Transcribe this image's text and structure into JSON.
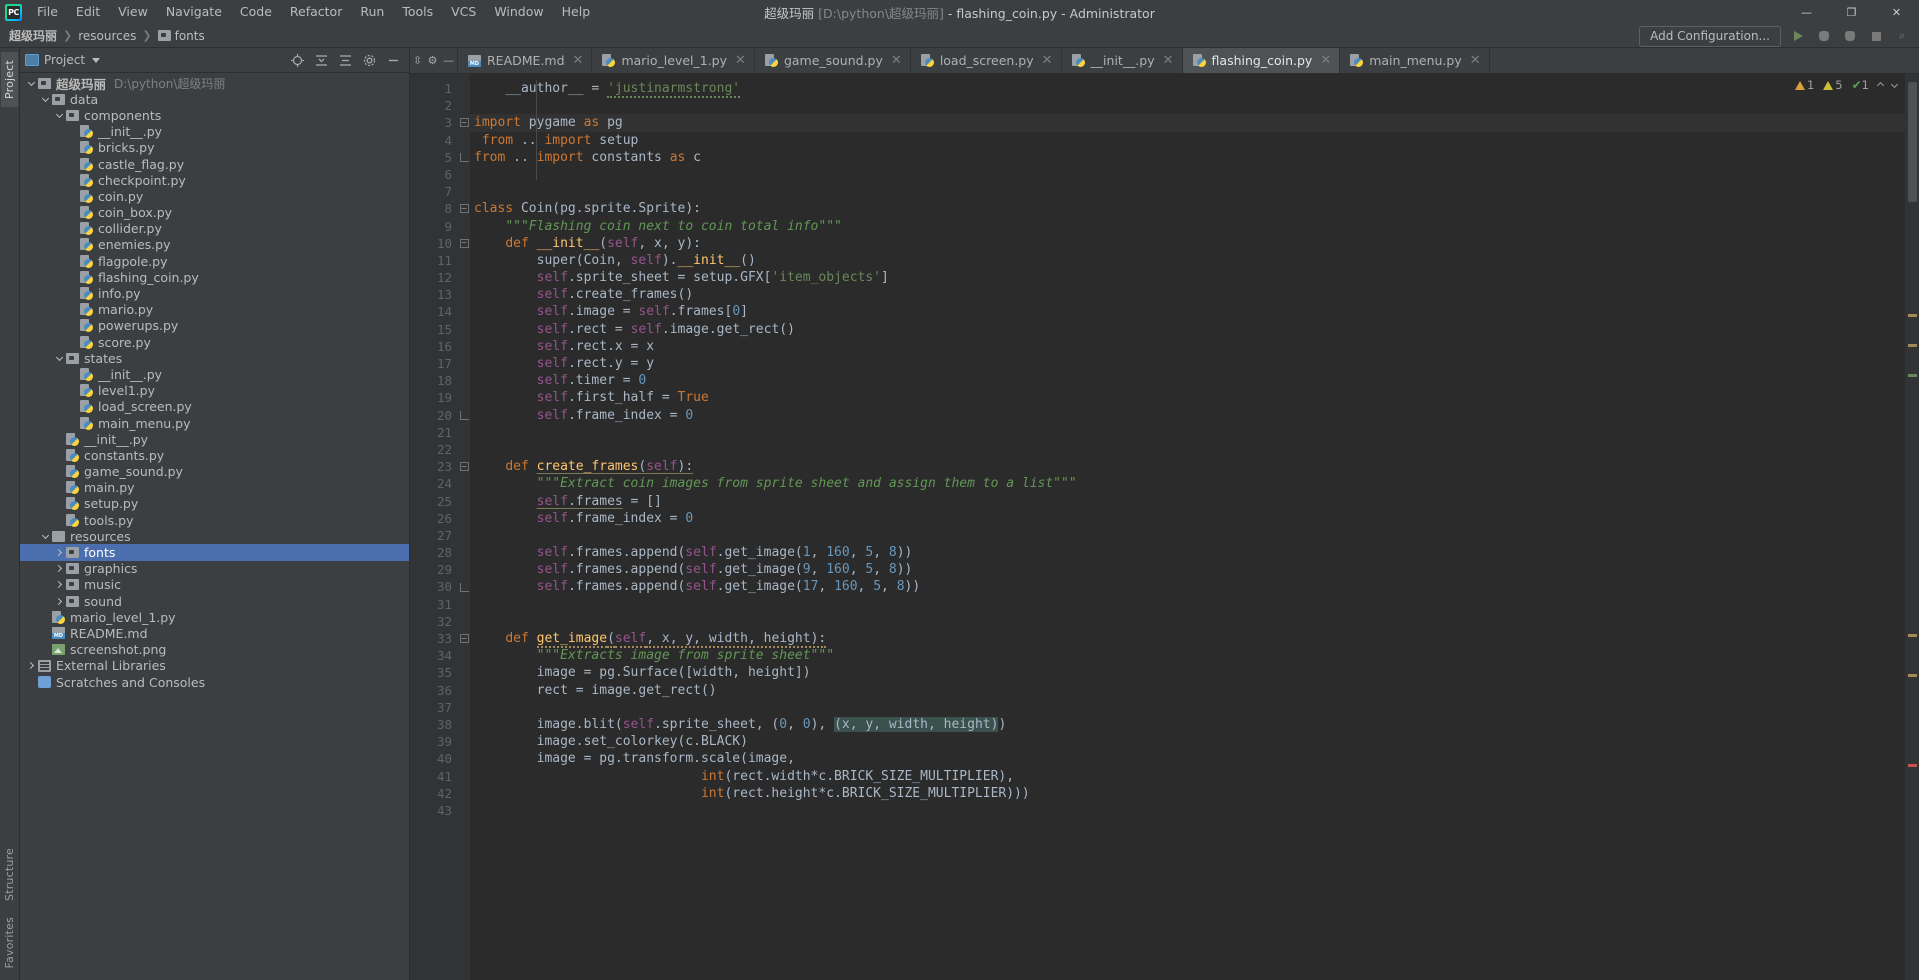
{
  "window": {
    "title_project": "超级玛丽",
    "title_path": "[D:\\python\\超级玛丽]",
    "title_file": "- flashing_coin.py - Administrator",
    "full_title": "超级玛丽 [D:\\python\\超级玛丽] - flashing_coin.py - Administrator",
    "minimize": "—",
    "maximize": "❐",
    "close": "✕"
  },
  "menubar": {
    "logo": "pycharm-logo",
    "items": [
      "File",
      "Edit",
      "View",
      "Navigate",
      "Code",
      "Refactor",
      "Run",
      "Tools",
      "VCS",
      "Window",
      "Help"
    ]
  },
  "breadcrumb": {
    "items": [
      {
        "label": "超级玛丽",
        "icon": "none",
        "bold": true
      },
      {
        "label": "resources",
        "icon": "none",
        "bold": false
      },
      {
        "label": "fonts",
        "icon": "folder-icon",
        "bold": false
      }
    ],
    "separator": "❯"
  },
  "run_toolbar": {
    "add_configuration": "Add Configuration...",
    "buttons": [
      "run-button",
      "debug-button",
      "coverage-button",
      "stop-button",
      "more-button"
    ]
  },
  "left_strip": {
    "project_tab": "Project",
    "structure_tab": "Structure",
    "favorites_tab": "Favorites"
  },
  "project_panel": {
    "title": "Project",
    "actions": [
      "locate-icon",
      "collapse-all-icon",
      "expand-icon",
      "settings-icon",
      "hide-icon"
    ],
    "tree": [
      {
        "depth": 0,
        "arrow": "down",
        "icon": "folder",
        "label": "超级玛丽",
        "bold": true,
        "path": "D:\\python\\超级玛丽",
        "selected": false
      },
      {
        "depth": 1,
        "arrow": "down",
        "icon": "folder",
        "label": "data",
        "selected": false
      },
      {
        "depth": 2,
        "arrow": "down",
        "icon": "folder",
        "label": "components",
        "selected": false
      },
      {
        "depth": 3,
        "arrow": "none",
        "icon": "py",
        "label": "__init__.py",
        "selected": false
      },
      {
        "depth": 3,
        "arrow": "none",
        "icon": "py",
        "label": "bricks.py",
        "selected": false
      },
      {
        "depth": 3,
        "arrow": "none",
        "icon": "py",
        "label": "castle_flag.py",
        "selected": false
      },
      {
        "depth": 3,
        "arrow": "none",
        "icon": "py",
        "label": "checkpoint.py",
        "selected": false
      },
      {
        "depth": 3,
        "arrow": "none",
        "icon": "py",
        "label": "coin.py",
        "selected": false
      },
      {
        "depth": 3,
        "arrow": "none",
        "icon": "py",
        "label": "coin_box.py",
        "selected": false
      },
      {
        "depth": 3,
        "arrow": "none",
        "icon": "py",
        "label": "collider.py",
        "selected": false
      },
      {
        "depth": 3,
        "arrow": "none",
        "icon": "py",
        "label": "enemies.py",
        "selected": false
      },
      {
        "depth": 3,
        "arrow": "none",
        "icon": "py",
        "label": "flagpole.py",
        "selected": false
      },
      {
        "depth": 3,
        "arrow": "none",
        "icon": "py",
        "label": "flashing_coin.py",
        "selected": false
      },
      {
        "depth": 3,
        "arrow": "none",
        "icon": "py",
        "label": "info.py",
        "selected": false
      },
      {
        "depth": 3,
        "arrow": "none",
        "icon": "py",
        "label": "mario.py",
        "selected": false
      },
      {
        "depth": 3,
        "arrow": "none",
        "icon": "py",
        "label": "powerups.py",
        "selected": false
      },
      {
        "depth": 3,
        "arrow": "none",
        "icon": "py",
        "label": "score.py",
        "selected": false
      },
      {
        "depth": 2,
        "arrow": "down",
        "icon": "folder",
        "label": "states",
        "selected": false
      },
      {
        "depth": 3,
        "arrow": "none",
        "icon": "py",
        "label": "__init__.py",
        "selected": false
      },
      {
        "depth": 3,
        "arrow": "none",
        "icon": "py",
        "label": "level1.py",
        "selected": false
      },
      {
        "depth": 3,
        "arrow": "none",
        "icon": "py",
        "label": "load_screen.py",
        "selected": false
      },
      {
        "depth": 3,
        "arrow": "none",
        "icon": "py",
        "label": "main_menu.py",
        "selected": false
      },
      {
        "depth": 2,
        "arrow": "none",
        "icon": "py",
        "label": "__init__.py",
        "selected": false
      },
      {
        "depth": 2,
        "arrow": "none",
        "icon": "py",
        "label": "constants.py",
        "selected": false
      },
      {
        "depth": 2,
        "arrow": "none",
        "icon": "py",
        "label": "game_sound.py",
        "selected": false
      },
      {
        "depth": 2,
        "arrow": "none",
        "icon": "py",
        "label": "main.py",
        "selected": false
      },
      {
        "depth": 2,
        "arrow": "none",
        "icon": "py",
        "label": "setup.py",
        "selected": false
      },
      {
        "depth": 2,
        "arrow": "none",
        "icon": "py",
        "label": "tools.py",
        "selected": false
      },
      {
        "depth": 1,
        "arrow": "down",
        "icon": "folder-plain",
        "label": "resources",
        "selected": false
      },
      {
        "depth": 2,
        "arrow": "right",
        "icon": "folder",
        "label": "fonts",
        "selected": true
      },
      {
        "depth": 2,
        "arrow": "right",
        "icon": "folder",
        "label": "graphics",
        "selected": false
      },
      {
        "depth": 2,
        "arrow": "right",
        "icon": "folder",
        "label": "music",
        "selected": false
      },
      {
        "depth": 2,
        "arrow": "right",
        "icon": "folder",
        "label": "sound",
        "selected": false
      },
      {
        "depth": 1,
        "arrow": "none",
        "icon": "py",
        "label": "mario_level_1.py",
        "selected": false
      },
      {
        "depth": 1,
        "arrow": "none",
        "icon": "md",
        "label": "README.md",
        "selected": false
      },
      {
        "depth": 1,
        "arrow": "none",
        "icon": "img",
        "label": "screenshot.png",
        "selected": false
      },
      {
        "depth": 0,
        "arrow": "right",
        "icon": "lib",
        "label": "External Libraries",
        "selected": false
      },
      {
        "depth": 0,
        "arrow": "none",
        "icon": "scratch",
        "label": "Scratches and Consoles",
        "selected": false
      }
    ]
  },
  "editor_tabs": [
    {
      "label": "README.md",
      "icon": "md-icon",
      "active": false,
      "close": "✕"
    },
    {
      "label": "mario_level_1.py",
      "icon": "py-icon",
      "active": false,
      "close": "✕"
    },
    {
      "label": "game_sound.py",
      "icon": "py-icon",
      "active": false,
      "close": "✕"
    },
    {
      "label": "load_screen.py",
      "icon": "py-icon",
      "active": false,
      "close": "✕"
    },
    {
      "label": "__init__.py",
      "icon": "py-icon",
      "active": false,
      "close": "✕"
    },
    {
      "label": "flashing_coin.py",
      "icon": "py-icon",
      "active": true,
      "close": "✕"
    },
    {
      "label": "main_menu.py",
      "icon": "py-icon",
      "active": false,
      "close": "✕"
    }
  ],
  "inspections": {
    "errors_count": "1",
    "warnings_count": "5",
    "weak_warnings_count": "1",
    "error_icon": "warning-triangle-icon",
    "warning_icon": "warning-triangle-icon",
    "ok_icon": "checkmark-icon",
    "prev_icon": "chevron-up-icon",
    "next_icon": "chevron-down-icon"
  },
  "editor": {
    "first_line": 1,
    "file": "flashing_coin.py",
    "lines": [
      {
        "n": 1,
        "fold": "none",
        "html": "<span class=\"pln\">    __author__ = </span><span class=\"str squig\">'justinarmstrong'</span>"
      },
      {
        "n": 2,
        "fold": "none",
        "html": ""
      },
      {
        "n": 3,
        "fold": "open",
        "hl": true,
        "html": "<span class=\"kw\">import</span><span class=\"pln\"> pygame </span><span class=\"kw\">as</span><span class=\"pln\"> pg</span>"
      },
      {
        "n": 4,
        "fold": "none",
        "html": " <span class=\"kw\">from</span><span class=\"pln\"> .. </span><span class=\"kw\">import</span><span class=\"pln\"> setup</span>"
      },
      {
        "n": 5,
        "fold": "end",
        "html": "<span class=\"kw\">from</span><span class=\"pln\"> .. </span><span class=\"kw\">import</span><span class=\"pln\"> constants </span><span class=\"kw\">as</span><span class=\"pln\"> c</span>"
      },
      {
        "n": 6,
        "fold": "none",
        "html": ""
      },
      {
        "n": 7,
        "fold": "none",
        "html": ""
      },
      {
        "n": 8,
        "fold": "open",
        "html": "<span class=\"kw\">class</span><span class=\"pln\"> Coin(pg.sprite.Sprite):</span>"
      },
      {
        "n": 9,
        "fold": "none",
        "html": "    <span class=\"cmt\">\"\"\"Flashing coin next to coin total info\"\"\"</span>"
      },
      {
        "n": 10,
        "fold": "open",
        "html": "    <span class=\"kw\">def</span><span class=\"pln\"> </span><span class=\"fn\">__init__</span><span class=\"pln\">(</span><span class=\"self\">self</span><span class=\"pln\">, x, y):</span>"
      },
      {
        "n": 11,
        "fold": "none",
        "html": "        <span class=\"pln\">super(Coin, </span><span class=\"self\">self</span><span class=\"pln\">).</span><span class=\"fn\">__init__</span><span class=\"pln\">()</span>"
      },
      {
        "n": 12,
        "fold": "none",
        "html": "        <span class=\"self\">self</span><span class=\"pln\">.sprite_sheet = setup.GFX[</span><span class=\"str\">'item_objects'</span><span class=\"pln\">]</span>"
      },
      {
        "n": 13,
        "fold": "none",
        "html": "        <span class=\"self\">self</span><span class=\"pln\">.create_frames()</span>"
      },
      {
        "n": 14,
        "fold": "none",
        "html": "        <span class=\"self\">self</span><span class=\"pln\">.image = </span><span class=\"self\">self</span><span class=\"pln\">.frames[</span><span class=\"num\">0</span><span class=\"pln\">]</span>"
      },
      {
        "n": 15,
        "fold": "none",
        "html": "        <span class=\"self\">self</span><span class=\"pln\">.rect = </span><span class=\"self\">self</span><span class=\"pln\">.image.get_rect()</span>"
      },
      {
        "n": 16,
        "fold": "none",
        "html": "        <span class=\"self\">self</span><span class=\"pln\">.rect.x = x</span>"
      },
      {
        "n": 17,
        "fold": "none",
        "html": "        <span class=\"self\">self</span><span class=\"pln\">.rect.y = y</span>"
      },
      {
        "n": 18,
        "fold": "none",
        "html": "        <span class=\"self\">self</span><span class=\"pln\">.timer = </span><span class=\"num\">0</span>"
      },
      {
        "n": 19,
        "fold": "none",
        "html": "        <span class=\"self\">self</span><span class=\"pln\">.first_half = </span><span class=\"kw\">True</span>"
      },
      {
        "n": 20,
        "fold": "end",
        "html": "        <span class=\"self\">self</span><span class=\"pln\">.frame_index = </span><span class=\"num\">0</span>"
      },
      {
        "n": 21,
        "fold": "none",
        "html": ""
      },
      {
        "n": 22,
        "fold": "none",
        "html": ""
      },
      {
        "n": 23,
        "fold": "open",
        "html": "    <span class=\"kw\">def</span><span class=\"pln\"> </span><span class=\"fn underl\">create_frames</span><span class=\"pln underl\">(</span><span class=\"self underl\">self</span><span class=\"pln underl\">):</span>"
      },
      {
        "n": 24,
        "fold": "none",
        "html": "        <span class=\"cmt\">\"\"\"Extract coin images from sprite sheet and assign them to a list\"\"\"</span>"
      },
      {
        "n": 25,
        "fold": "none",
        "html": "        <span class=\"self underl\">self</span><span class=\"pln underl\">.frames</span><span class=\"pln\"> = []</span>"
      },
      {
        "n": 26,
        "fold": "none",
        "html": "        <span class=\"self\">self</span><span class=\"pln\">.frame_index = </span><span class=\"num\">0</span>"
      },
      {
        "n": 27,
        "fold": "none",
        "html": ""
      },
      {
        "n": 28,
        "fold": "none",
        "html": "        <span class=\"self\">self</span><span class=\"pln\">.frames.append(</span><span class=\"self\">self</span><span class=\"pln\">.get_image(</span><span class=\"num\">1</span><span class=\"pln\">, </span><span class=\"num\">160</span><span class=\"pln\">, </span><span class=\"num\">5</span><span class=\"pln\">, </span><span class=\"num\">8</span><span class=\"pln\">))</span>"
      },
      {
        "n": 29,
        "fold": "none",
        "html": "        <span class=\"self\">self</span><span class=\"pln\">.frames.append(</span><span class=\"self\">self</span><span class=\"pln\">.get_image(</span><span class=\"num\">9</span><span class=\"pln\">, </span><span class=\"num\">160</span><span class=\"pln\">, </span><span class=\"num\">5</span><span class=\"pln\">, </span><span class=\"num\">8</span><span class=\"pln\">))</span>"
      },
      {
        "n": 30,
        "fold": "end",
        "html": "        <span class=\"self\">self</span><span class=\"pln\">.frames.append(</span><span class=\"self\">self</span><span class=\"pln\">.get_image(</span><span class=\"num\">17</span><span class=\"pln\">, </span><span class=\"num\">160</span><span class=\"pln\">, </span><span class=\"num\">5</span><span class=\"pln\">, </span><span class=\"num\">8</span><span class=\"pln\">))</span>"
      },
      {
        "n": 31,
        "fold": "none",
        "html": ""
      },
      {
        "n": 32,
        "fold": "none",
        "html": ""
      },
      {
        "n": 33,
        "fold": "open",
        "html": "    <span class=\"kw\">def</span><span class=\"pln\"> </span><span class=\"fn squig-w\">get_image</span><span class=\"pln squig-w\">(</span><span class=\"self squig-w\">self</span><span class=\"pln squig-w\">, x, y, width, height):</span>"
      },
      {
        "n": 34,
        "fold": "none",
        "html": "        <span class=\"cmt\">\"\"\"Extracts image from sprite sheet\"\"\"</span>"
      },
      {
        "n": 35,
        "fold": "none",
        "html": "        <span class=\"pln\">image = pg.Surface([width, height])</span>"
      },
      {
        "n": 36,
        "fold": "none",
        "html": "        <span class=\"pln\">rect = image.get_rect()</span>"
      },
      {
        "n": 37,
        "fold": "none",
        "html": ""
      },
      {
        "n": 38,
        "fold": "none",
        "html": "        <span class=\"pln\">image.blit(</span><span class=\"self\">self</span><span class=\"pln\">.sprite_sheet, (</span><span class=\"num\">0</span><span class=\"pln\">, </span><span class=\"num\">0</span><span class=\"pln\">), </span><span class=\"sel-hl\"><span class=\"pln\">(x, y, width, height)</span></span><span class=\"pln\">)</span>"
      },
      {
        "n": 39,
        "fold": "none",
        "html": "        <span class=\"pln\">image.set_colorkey(c.BLACK)</span>"
      },
      {
        "n": 40,
        "fold": "none",
        "html": "        <span class=\"pln\">image = pg.transform.scale(image,</span>"
      },
      {
        "n": 41,
        "fold": "none",
        "html": "                             <span class=\"kw\">int</span><span class=\"pln\">(rect.width*c.BRICK_SIZE_MULTIPLIER),</span>"
      },
      {
        "n": 42,
        "fold": "none",
        "html": "                             <span class=\"kw\">int</span><span class=\"pln\">(rect.height*c.BRICK_SIZE_MULTIPLIER)))</span>"
      },
      {
        "n": 43,
        "fold": "none",
        "html": ""
      }
    ]
  }
}
